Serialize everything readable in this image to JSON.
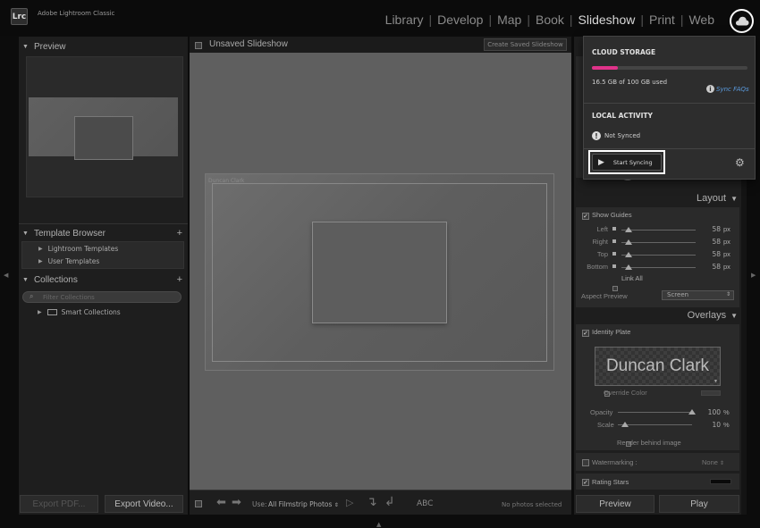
{
  "app": {
    "logo": "Lrc",
    "name": "Adobe Lightroom Classic"
  },
  "modules": [
    {
      "label": "Library",
      "active": false
    },
    {
      "label": "Develop",
      "active": false
    },
    {
      "label": "Map",
      "active": false
    },
    {
      "label": "Book",
      "active": false
    },
    {
      "label": "Slideshow",
      "active": true
    },
    {
      "label": "Print",
      "active": false
    },
    {
      "label": "Web",
      "active": false
    }
  ],
  "left": {
    "preview_title": "Preview",
    "template_browser_title": "Template Browser",
    "templates": [
      "Lightroom Templates",
      "User Templates"
    ],
    "collections_title": "Collections",
    "filter_placeholder": "Filter Collections",
    "smart_collections": "Smart Collections",
    "export_pdf": "Export PDF...",
    "export_video": "Export Video..."
  },
  "center": {
    "title": "Unsaved Slideshow",
    "create_saved": "Create Saved Slideshow",
    "identity_small": "Duncan Clark",
    "toolbar": {
      "use_label": "Use:",
      "use_value": "All Filmstrip Photos",
      "abc": "ABC",
      "status": "No photos selected"
    }
  },
  "right": {
    "layout_title": "Layout",
    "show_guides": "Show Guides",
    "guides": [
      {
        "label": "Left",
        "value": "58",
        "unit": "px"
      },
      {
        "label": "Right",
        "value": "58",
        "unit": "px"
      },
      {
        "label": "Top",
        "value": "58",
        "unit": "px"
      },
      {
        "label": "Bottom",
        "value": "58",
        "unit": "px"
      }
    ],
    "link_all": "Link All",
    "aspect_label": "Aspect Preview",
    "aspect_value": "Screen",
    "overlays_title": "Overlays",
    "identity_plate": "Identity Plate",
    "identity_text": "Duncan Clark",
    "override_color": "Override Color",
    "opacity_label": "Opacity",
    "opacity_value": "100",
    "scale_label": "Scale",
    "scale_value": "10",
    "percent": "%",
    "render_behind": "Render behind image",
    "watermarking": "Watermarking :",
    "watermark_value": "None",
    "rating_stars": "Rating Stars",
    "preview_btn": "Preview",
    "play_btn": "Play"
  },
  "cloud": {
    "storage_title": "CLOUD STORAGE",
    "usage": "16.5 GB of 100 GB used",
    "usage_fraction": 0.165,
    "sync_faqs": "Sync FAQs",
    "local_title": "LOCAL ACTIVITY",
    "status": "Not Synced",
    "start_sync": "Start Syncing"
  },
  "colors": {
    "accent": "#e0338a",
    "sync_link": "#5b9ce0"
  }
}
